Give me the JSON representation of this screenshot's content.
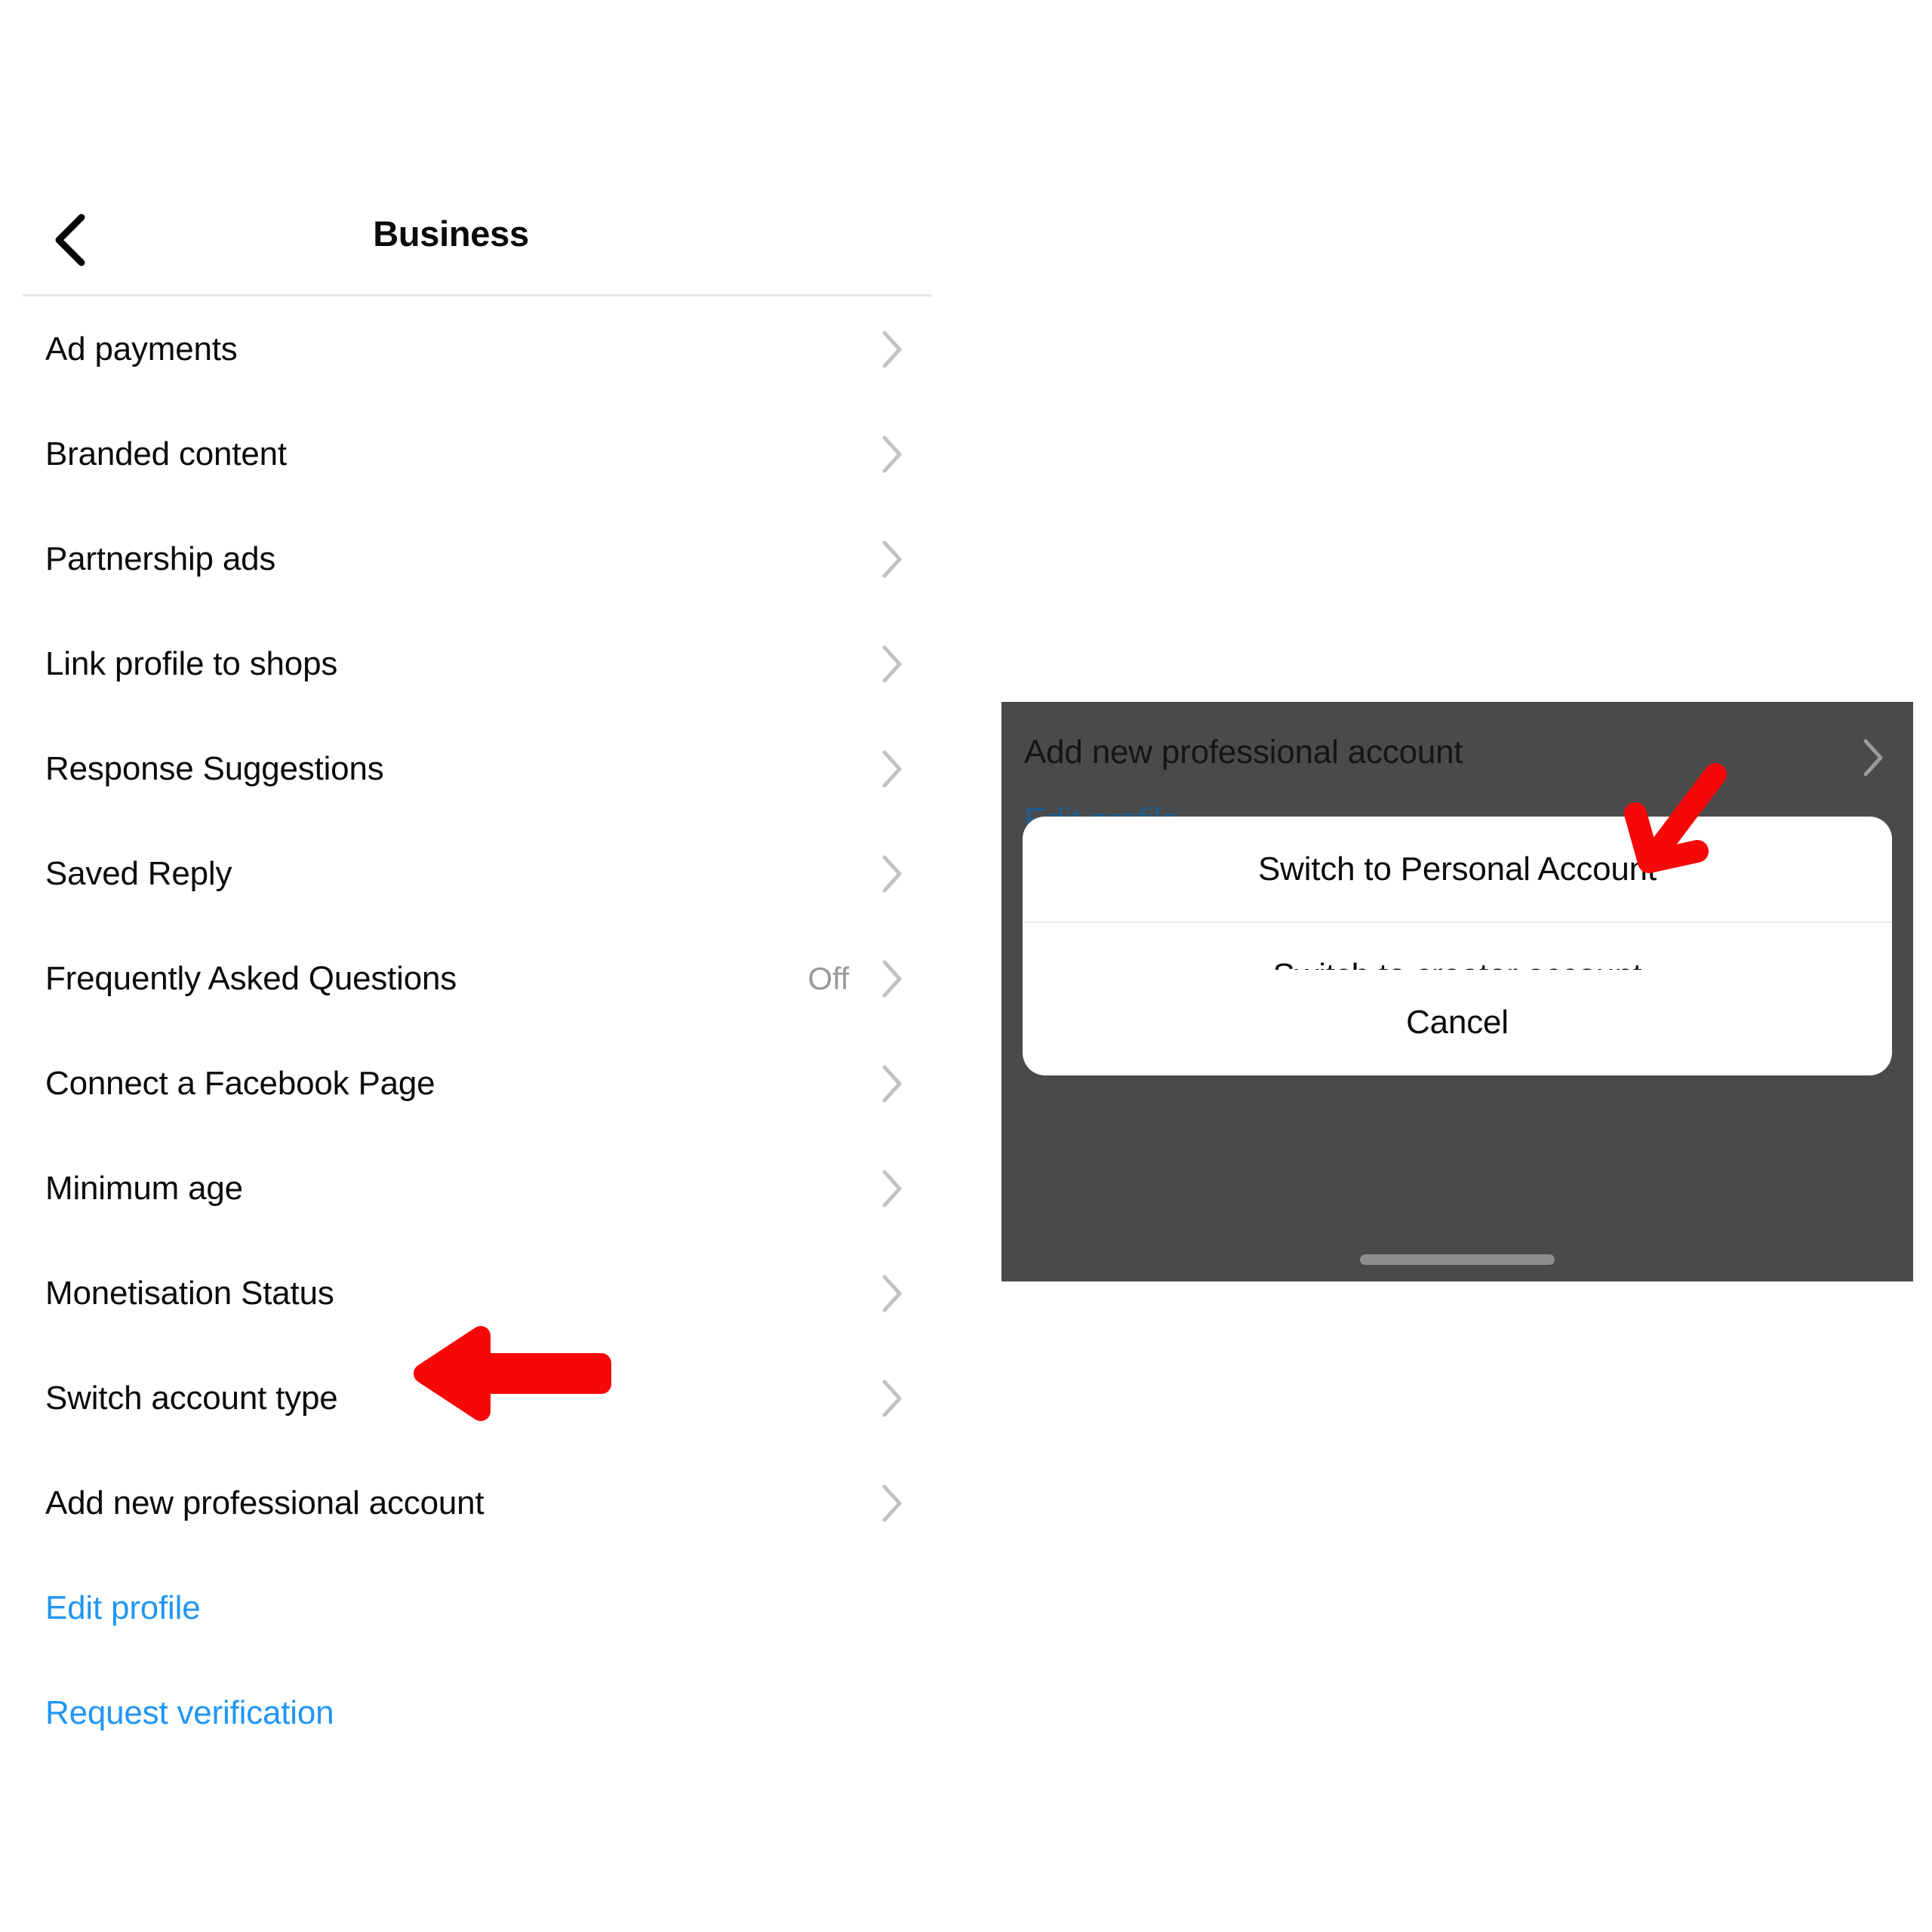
{
  "colors": {
    "accent_blue": "#2196f3",
    "annotation_red": "#f60808",
    "overlay_gray": "#4a4a4a",
    "value_gray": "#9a9a9a",
    "text_black": "#0b0b0b",
    "divider_gray": "#e6e6e6",
    "home_indicator_gray": "#8d8d8d"
  },
  "left_screen": {
    "nav": {
      "back_icon": "chevron-left-icon",
      "title": "Business"
    },
    "rows": [
      {
        "label": "Ad payments",
        "value": "",
        "chevron": "chevron-right-icon"
      },
      {
        "label": "Branded content",
        "value": "",
        "chevron": "chevron-right-icon"
      },
      {
        "label": "Partnership ads",
        "value": "",
        "chevron": "chevron-right-icon"
      },
      {
        "label": "Link profile to shops",
        "value": "",
        "chevron": "chevron-right-icon"
      },
      {
        "label": "Response Suggestions",
        "value": "",
        "chevron": "chevron-right-icon"
      },
      {
        "label": "Saved Reply",
        "value": "",
        "chevron": "chevron-right-icon"
      },
      {
        "label": "Frequently Asked Questions",
        "value": "Off",
        "chevron": "chevron-right-icon"
      },
      {
        "label": "Connect a Facebook Page",
        "value": "",
        "chevron": "chevron-right-icon"
      },
      {
        "label": "Minimum age",
        "value": "",
        "chevron": "chevron-right-icon"
      },
      {
        "label": "Monetisation Status",
        "value": "",
        "chevron": "chevron-right-icon"
      },
      {
        "label": "Switch account type",
        "value": "",
        "chevron": "chevron-right-icon"
      },
      {
        "label": "Add new professional account",
        "value": "",
        "chevron": "chevron-right-icon"
      }
    ],
    "links": [
      {
        "label": "Edit profile"
      },
      {
        "label": "Request verification"
      }
    ],
    "annotation": {
      "icon": "arrow-left-icon",
      "points_at": "Switch account type"
    }
  },
  "right_screen": {
    "dimmed_background": {
      "row_label": "Add new professional account",
      "row_chevron": "chevron-right-icon",
      "link_label": "Edit profile"
    },
    "action_sheet": {
      "options": [
        {
          "label": "Switch to Personal Account"
        },
        {
          "label": "Switch to creator account"
        }
      ],
      "cancel_label": "Cancel"
    },
    "home_indicator": "home-indicator-bar",
    "annotation": {
      "icon": "arrow-down-left-icon",
      "points_at": "Switch to Personal Account"
    }
  }
}
